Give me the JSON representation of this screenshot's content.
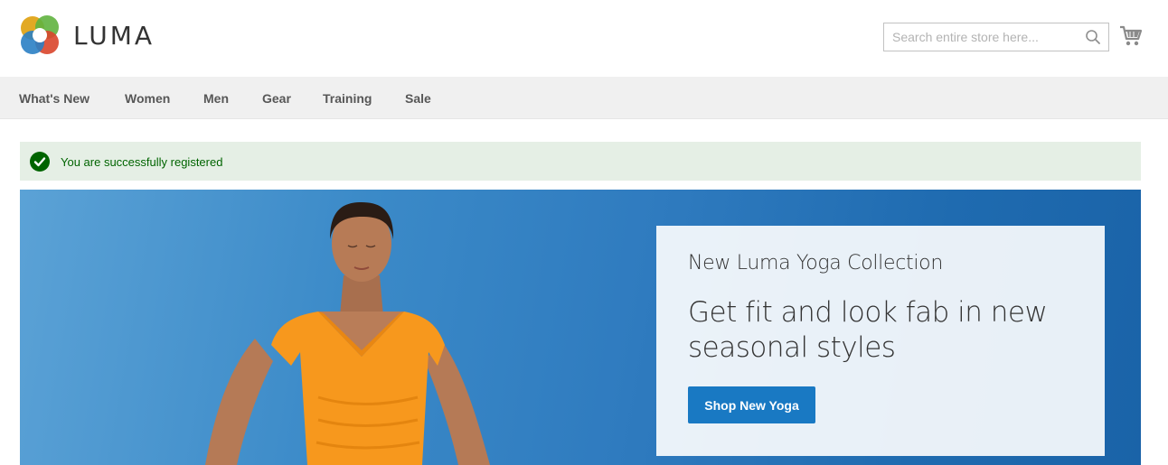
{
  "brand": {
    "name": "LUMA"
  },
  "search": {
    "placeholder": "Search entire store here...",
    "value": ""
  },
  "icons": {
    "search": "search-icon",
    "cart": "cart-icon",
    "success": "checkmark-circle-icon"
  },
  "nav": {
    "items": [
      {
        "label": "What's New"
      },
      {
        "label": "Women"
      },
      {
        "label": "Men"
      },
      {
        "label": "Gear"
      },
      {
        "label": "Training"
      },
      {
        "label": "Sale"
      }
    ]
  },
  "message": {
    "text": "You are successfully registered",
    "color": "#006400",
    "background": "#e5efe5"
  },
  "hero": {
    "subtitle": "New Luma Yoga Collection",
    "title": "Get fit and look fab in new seasonal styles",
    "button_label": "Shop New Yoga",
    "accent": "#1979c3"
  }
}
